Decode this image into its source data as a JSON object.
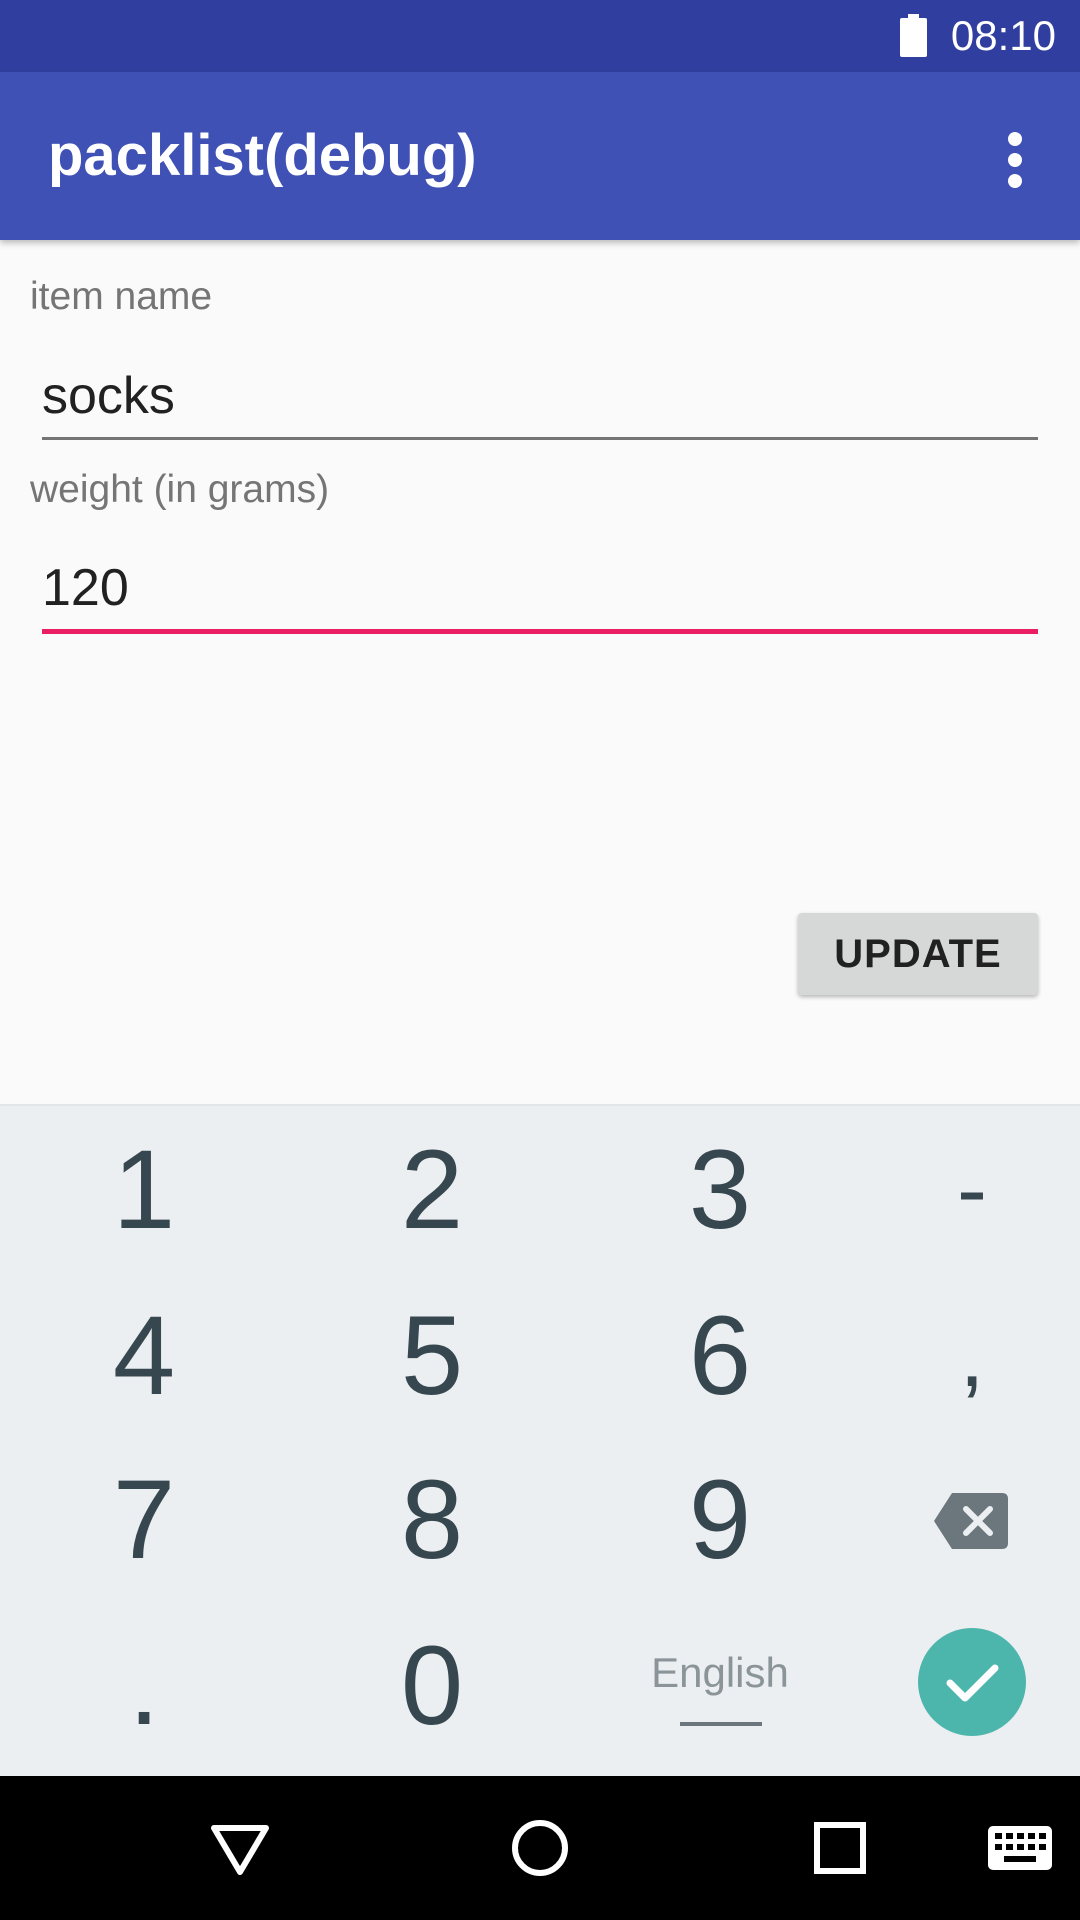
{
  "status_bar": {
    "time": "08:10",
    "battery_icon": "battery-full-icon"
  },
  "app_bar": {
    "title": "packlist(debug)",
    "overflow_icon": "more-vert-icon"
  },
  "form": {
    "item_name_label": "item name",
    "item_name_value": "socks",
    "weight_label": "weight (in grams)",
    "weight_value": "120",
    "update_button": "UPDATE"
  },
  "keyboard": {
    "rows": [
      [
        "1",
        "2",
        "3",
        "-"
      ],
      [
        "4",
        "5",
        "6",
        ","
      ],
      [
        "7",
        "8",
        "9",
        ""
      ],
      [
        ".",
        "0",
        "",
        ""
      ]
    ],
    "language": "English",
    "backspace_icon": "backspace-icon",
    "enter_icon": "check-icon"
  },
  "nav_bar": {
    "icons": [
      "back-icon",
      "home-icon",
      "recents-icon",
      "keyboard-switch-icon"
    ]
  },
  "colors": {
    "status_bar": "#303f9f",
    "app_bar": "#3f51b5",
    "focus_accent": "#e91e63",
    "enter_button": "#4db6ac",
    "keyboard_bg": "#eceff1"
  }
}
